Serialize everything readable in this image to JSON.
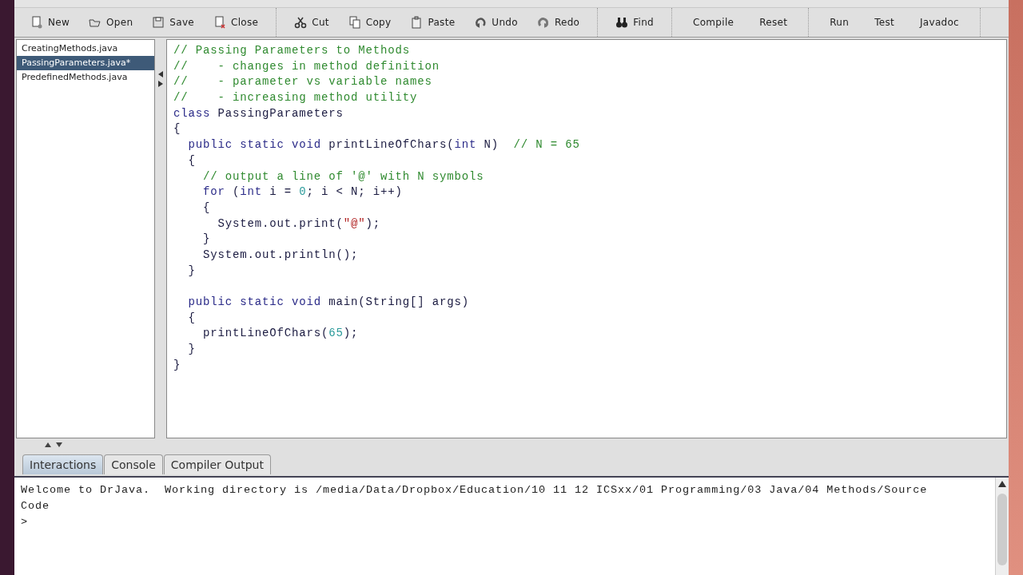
{
  "toolbar": {
    "groups": [
      [
        {
          "label": "New",
          "kind": "icon-button"
        },
        {
          "label": "Open",
          "kind": "icon-button"
        },
        {
          "label": "Save",
          "kind": "icon-button"
        },
        {
          "label": "Close",
          "kind": "icon-button"
        }
      ],
      [
        {
          "label": "Cut",
          "kind": "icon-button"
        },
        {
          "label": "Copy",
          "kind": "icon-button"
        },
        {
          "label": "Paste",
          "kind": "icon-button"
        },
        {
          "label": "Undo",
          "kind": "icon-button"
        },
        {
          "label": "Redo",
          "kind": "icon-button"
        }
      ],
      [
        {
          "label": "Find",
          "kind": "icon-button"
        }
      ],
      [
        {
          "label": "Compile",
          "kind": "text-button"
        },
        {
          "label": "Reset",
          "kind": "text-button"
        }
      ],
      [
        {
          "label": "Run",
          "kind": "text-button"
        },
        {
          "label": "Test",
          "kind": "text-button"
        },
        {
          "label": "Javadoc",
          "kind": "text-button"
        }
      ]
    ]
  },
  "files": [
    {
      "name": "CreatingMethods.java",
      "selected": false
    },
    {
      "name": "PassingParameters.java*",
      "selected": true
    },
    {
      "name": "PredefinedMethods.java",
      "selected": false
    }
  ],
  "editor": {
    "lines": [
      [
        {
          "kind": "comment",
          "text": "// Passing Parameters to Methods"
        }
      ],
      [
        {
          "kind": "comment",
          "text": "//    - changes in method definition"
        }
      ],
      [
        {
          "kind": "comment",
          "text": "//    - parameter vs variable names"
        }
      ],
      [
        {
          "kind": "comment",
          "text": "//    - increasing method utility"
        }
      ],
      [
        {
          "kind": "keyword",
          "text": "class"
        },
        {
          "kind": "plain",
          "text": " PassingParameters"
        }
      ],
      [
        {
          "kind": "plain",
          "text": "{"
        }
      ],
      [
        {
          "kind": "keyword",
          "text": "  public static void"
        },
        {
          "kind": "plain",
          "text": " printLineOfChars("
        },
        {
          "kind": "keyword",
          "text": "int"
        },
        {
          "kind": "plain",
          "text": " N)  "
        },
        {
          "kind": "comment",
          "text": "// N = 65"
        }
      ],
      [
        {
          "kind": "plain",
          "text": "  {"
        }
      ],
      [
        {
          "kind": "comment",
          "text": "    // output a line of '@' with N symbols"
        }
      ],
      [
        {
          "kind": "keyword",
          "text": "    for"
        },
        {
          "kind": "plain",
          "text": " ("
        },
        {
          "kind": "keyword",
          "text": "int"
        },
        {
          "kind": "plain",
          "text": " i = "
        },
        {
          "kind": "number",
          "text": "0"
        },
        {
          "kind": "plain",
          "text": "; i < N; i++)"
        }
      ],
      [
        {
          "kind": "plain",
          "text": "    {"
        }
      ],
      [
        {
          "kind": "plain",
          "text": "      System.out.print("
        },
        {
          "kind": "string",
          "text": "\"@\""
        },
        {
          "kind": "plain",
          "text": ");"
        }
      ],
      [
        {
          "kind": "plain",
          "text": "    }"
        }
      ],
      [
        {
          "kind": "plain",
          "text": "    System.out.println();"
        }
      ],
      [
        {
          "kind": "plain",
          "text": "  }"
        }
      ],
      [
        {
          "kind": "blank"
        }
      ],
      [
        {
          "kind": "keyword",
          "text": "  public static void"
        },
        {
          "kind": "plain",
          "text": " main(String[] args)"
        }
      ],
      [
        {
          "kind": "plain",
          "text": "  {"
        }
      ],
      [
        {
          "kind": "plain",
          "text": "    printLineOfChars("
        },
        {
          "kind": "number",
          "text": "65"
        },
        {
          "kind": "plain",
          "text": ");"
        }
      ],
      [
        {
          "kind": "plain",
          "text": "  }"
        }
      ],
      [
        {
          "kind": "plain",
          "text": "}"
        }
      ]
    ]
  },
  "tabs": [
    {
      "label": "Interactions",
      "selected": true
    },
    {
      "label": "Console",
      "selected": false
    },
    {
      "label": "Compiler Output",
      "selected": false
    }
  ],
  "console": {
    "lines": [
      "Welcome to DrJava.  Working directory is /media/Data/Dropbox/Education/10 11 12 ICSxx/01 Programming/03 Java/04 Methods/Source",
      "Code",
      ">"
    ]
  }
}
